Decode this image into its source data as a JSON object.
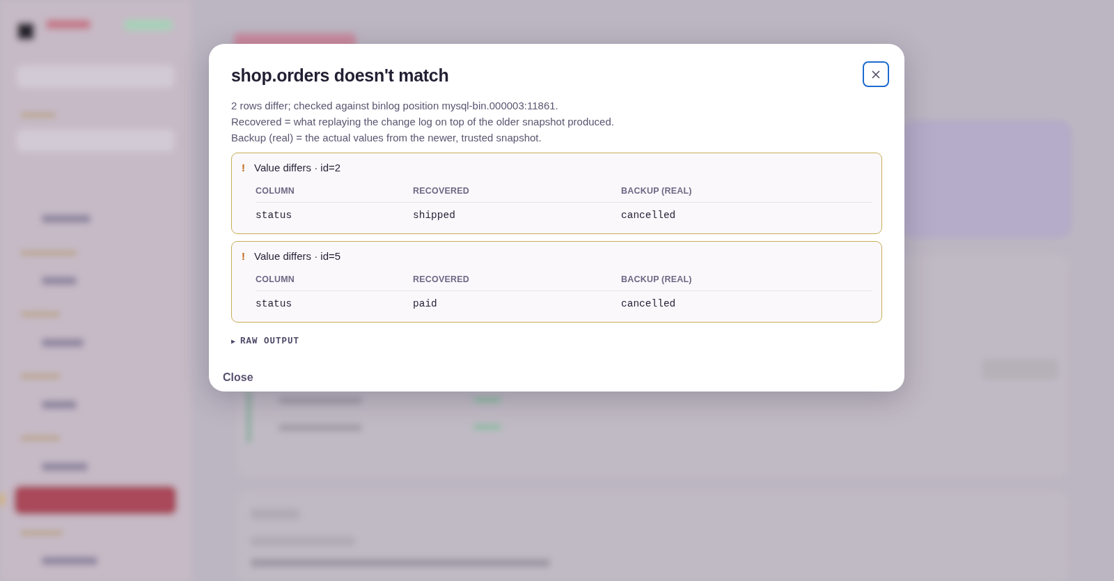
{
  "dialog": {
    "title": "shop.orders doesn't match",
    "description": [
      "2 rows differ; checked against binlog position mysql-bin.000003:11861.",
      "Recovered = what replaying the change log on top of the older snapshot produced.",
      "Backup (real) = the actual values from the newer, trusted snapshot."
    ],
    "diffs": [
      {
        "marker": "!",
        "title": "Value differs · id=2",
        "columns": [
          "COLUMN",
          "RECOVERED",
          "BACKUP (REAL)"
        ],
        "rows": [
          [
            "status",
            "shipped",
            "cancelled"
          ]
        ]
      },
      {
        "marker": "!",
        "title": "Value differs · id=5",
        "columns": [
          "COLUMN",
          "RECOVERED",
          "BACKUP (REAL)"
        ],
        "rows": [
          [
            "status",
            "paid",
            "cancelled"
          ]
        ]
      }
    ],
    "raw_output": {
      "marker": "▶",
      "label": "RAW OUTPUT",
      "expanded": false
    },
    "footer_button": "Close"
  }
}
